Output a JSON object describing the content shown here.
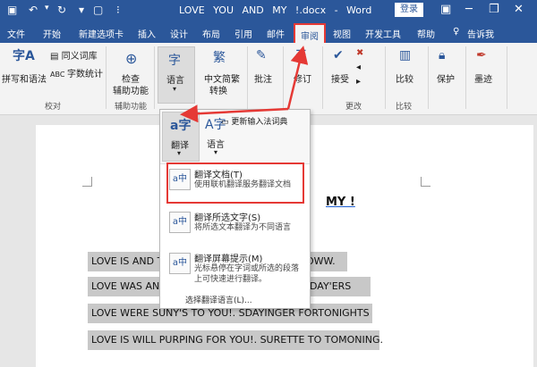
{
  "titlebar": {
    "title": "LOVE   YOU   AND   MY  !.docx - Word",
    "login": "登录",
    "minimize": "─",
    "restore": "❐",
    "close": "✕"
  },
  "tabs": [
    "文件",
    "开始",
    "新建选项卡",
    "插入",
    "设计",
    "布局",
    "引用",
    "邮件",
    "审阅",
    "视图",
    "开发工具",
    "帮助",
    "告诉我"
  ],
  "active_tab": "审阅",
  "ribbon": {
    "spelling": "拼写和语法",
    "thesaurus": "同义词库",
    "wordcount": "字数统计",
    "group_proofing": "校对",
    "check_access_1": "检查",
    "check_access_2": "辅助功能",
    "group_access": "辅助功能",
    "language": "语言",
    "chinese_conv_1": "中文简繁",
    "chinese_conv_2": "转换",
    "comment": "批注",
    "track": "修订",
    "accept": "接受",
    "group_changes": "更改",
    "compare": "比较",
    "group_compare": "比较",
    "protect": "保护",
    "ink": "墨迹"
  },
  "popup": {
    "translate_label": "翻译",
    "language_label": "语言",
    "update_ime": "更新输入法词典",
    "items": [
      {
        "title": "翻译文档(T)",
        "desc": "使用联机翻译服务翻译文档"
      },
      {
        "title": "翻译所选文字(S)",
        "desc": "将所选文本翻译为不同语言"
      },
      {
        "title": "翻译屏幕提示(M)",
        "desc": "光标悬停在字词或所选的段落上可快速进行翻译。"
      }
    ],
    "choose_lang": "选择翻译语言(L)..."
  },
  "document": {
    "title": "MY  !",
    "lines": [
      "LOVE IS AND TO",
      "LOVE WAS AND",
      "LOVE WERE SUNY'S TO YOU!. SDAYINGER FORTONIGHTS",
      "LOVE IS WILL PURPING FOR YOU!. SURETTE TO TOMONING."
    ],
    "line_tails": [
      "OWW.",
      "DAY'ERS"
    ]
  }
}
